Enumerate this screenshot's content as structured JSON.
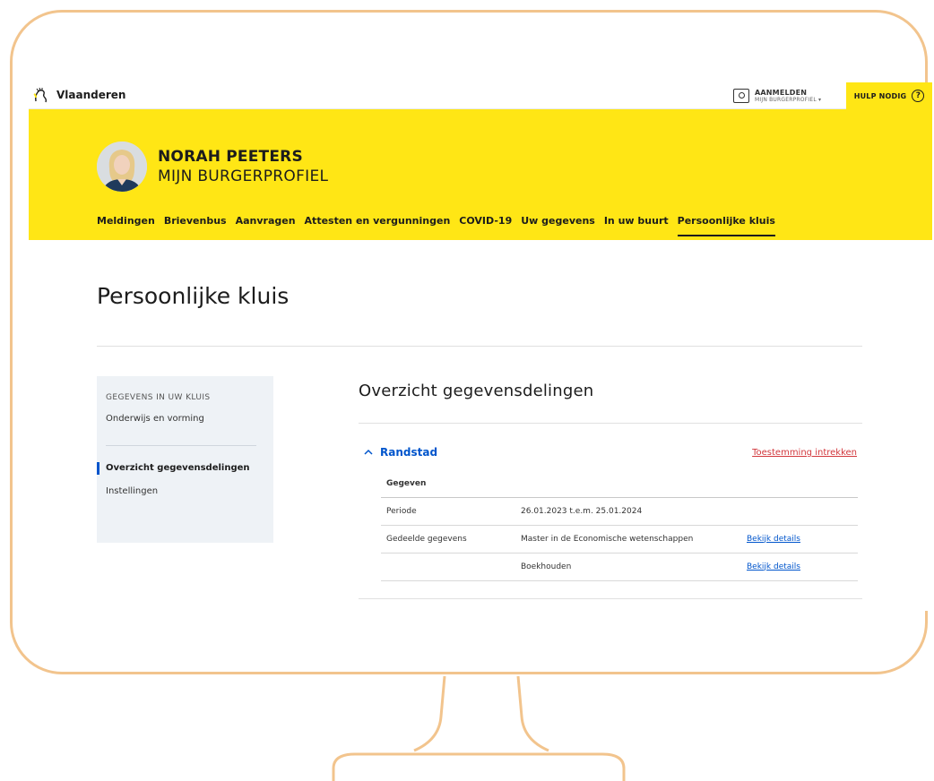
{
  "topbar": {
    "brand": "Vlaanderen",
    "login_label": "AANMELDEN",
    "login_sub": "MIJN BURGERPROFIEL ▾",
    "help_label": "HULP NODIG",
    "help_icon": "?"
  },
  "profile": {
    "name": "NORAH PEETERS",
    "subtitle": "MIJN BURGERPROFIEL"
  },
  "nav": {
    "items": [
      {
        "label": "Meldingen"
      },
      {
        "label": "Brievenbus"
      },
      {
        "label": "Aanvragen"
      },
      {
        "label": "Attesten en vergunningen"
      },
      {
        "label": "COVID-19"
      },
      {
        "label": "Uw gegevens"
      },
      {
        "label": "In uw buurt"
      },
      {
        "label": "Persoonlijke kluis",
        "active": true
      }
    ]
  },
  "page": {
    "title": "Persoonlijke kluis"
  },
  "sidenav": {
    "heading": "GEGEVENS IN UW KLUIS",
    "items": [
      {
        "label": "Onderwijs en vorming"
      },
      {
        "label": "Overzicht gegevensdelingen",
        "active": true
      },
      {
        "label": "Instellingen"
      }
    ]
  },
  "main": {
    "section_title": "Overzicht gegevensdelingen",
    "accordion": {
      "title": "Randstad",
      "revoke_label": "Toestemming intrekken",
      "table": {
        "header": "Gegeven",
        "rows": [
          {
            "label": "Periode",
            "value": "26.01.2023 t.e.m. 25.01.2024",
            "link": ""
          },
          {
            "label": "Gedeelde gegevens",
            "value": "Master in de Economische wetenschappen",
            "link": "Bekijk details"
          },
          {
            "label": "",
            "value": "Boekhouden",
            "link": "Bekijk details"
          }
        ]
      }
    }
  },
  "colors": {
    "brand_yellow": "#ffe615",
    "link_blue": "#0055cc",
    "danger_red": "#d2373c",
    "frame_orange": "#f2c48d"
  }
}
